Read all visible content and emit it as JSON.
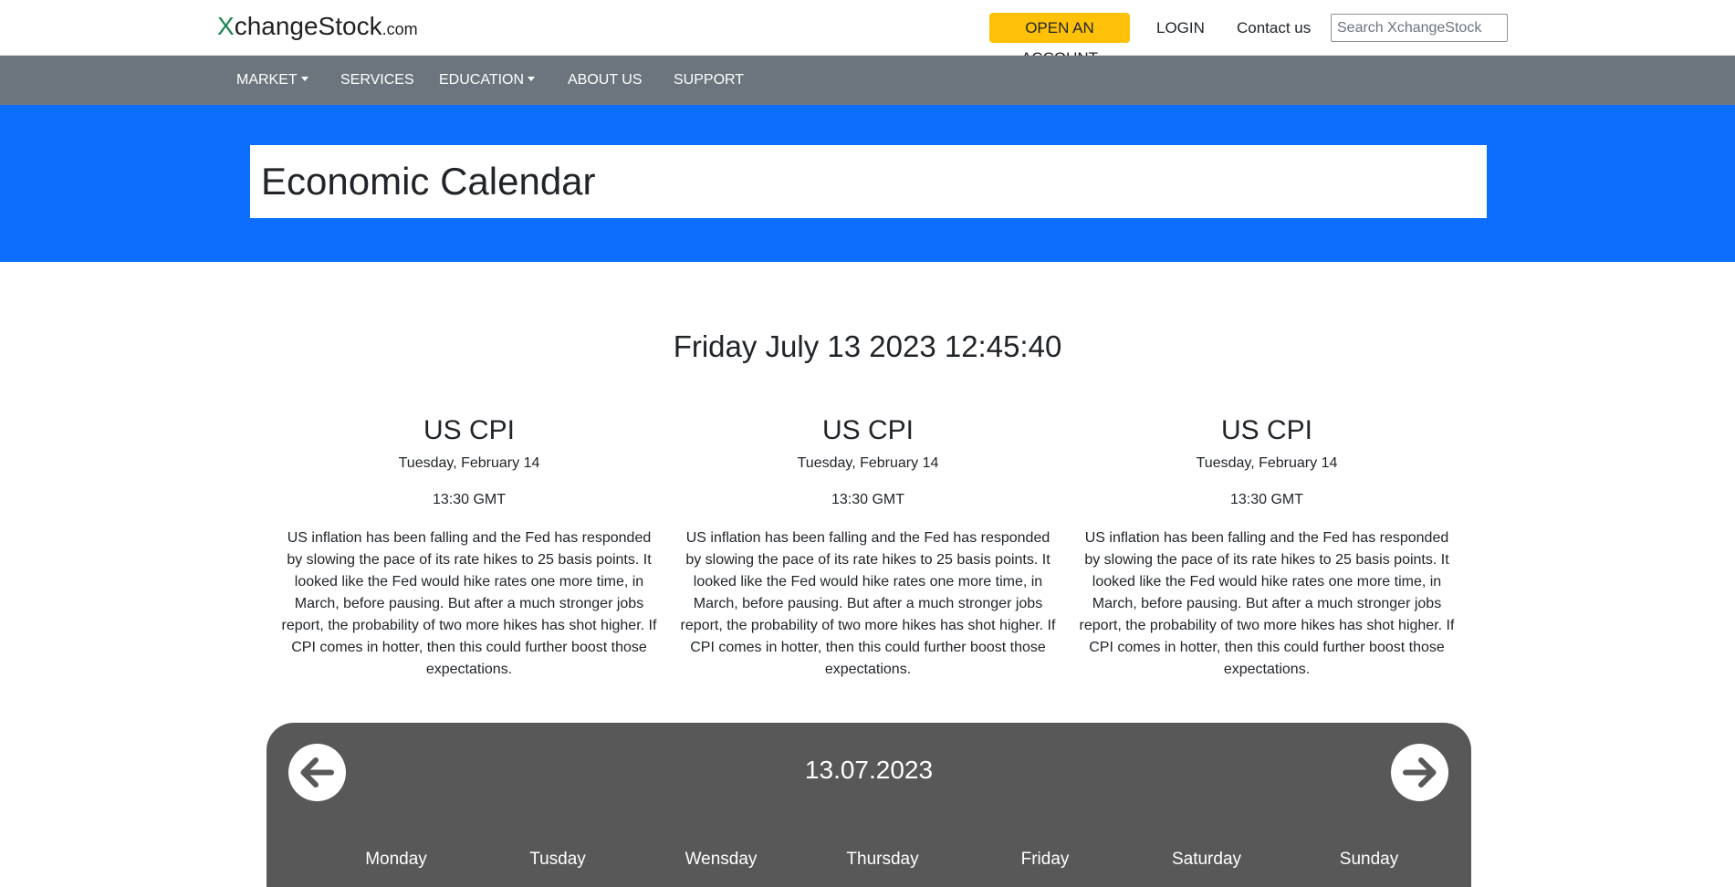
{
  "header": {
    "logo": {
      "initial": "X",
      "rest": "changeStock",
      "suffix": ".com"
    },
    "open_account_label": "OPEN AN ACCOUNT",
    "login_label": "LOGIN",
    "contact_label": "Contact us",
    "search": {
      "placeholder": "Search XchangeStock",
      "value": ""
    },
    "colors": {
      "logo_initial": "#198754",
      "open_account_bg": "#ffc107"
    }
  },
  "nav": {
    "items": [
      {
        "label": "MARKET",
        "dropdown": true
      },
      {
        "label": "SERVICES",
        "dropdown": false
      },
      {
        "label": "EDUCATION",
        "dropdown": true
      },
      {
        "label": "ABOUT US",
        "dropdown": false
      },
      {
        "label": "SUPPORT",
        "dropdown": false
      }
    ],
    "background": "#6c757d"
  },
  "hero": {
    "title": "Economic Calendar",
    "background": "#0d6efd"
  },
  "clock": {
    "text": "Friday July 13 2023 12:45:40"
  },
  "events": [
    {
      "title": "US CPI",
      "date": "Tuesday, February 14",
      "time": "13:30 GMT",
      "description": "US inflation has been falling and the Fed has responded by slowing the pace of its rate hikes to 25 basis points. It looked like the Fed would hike rates one more time, in March, before pausing. But after a much stronger jobs report, the probability of two more hikes has shot higher. If CPI comes in hotter, then this could further boost those expectations."
    },
    {
      "title": "US CPI",
      "date": "Tuesday, February 14",
      "time": "13:30 GMT",
      "description": "US inflation has been falling and the Fed has responded by slowing the pace of its rate hikes to 25 basis points. It looked like the Fed would hike rates one more time, in March, before pausing. But after a much stronger jobs report, the probability of two more hikes has shot higher. If CPI comes in hotter, then this could further boost those expectations."
    },
    {
      "title": "US CPI",
      "date": "Tuesday, February 14",
      "time": "13:30 GMT",
      "description": "US inflation has been falling and the Fed has responded by slowing the pace of its rate hikes to 25 basis points. It looked like the Fed would hike rates one more time, in March, before pausing. But after a much stronger jobs report, the probability of two more hikes has shot higher. If CPI comes in hotter, then this could further boost those expectations."
    }
  ],
  "calendar": {
    "current_date": "13.07.2023",
    "prev_icon": "arrow-left-icon",
    "next_icon": "arrow-right-icon",
    "weekdays": [
      "Monday",
      "Tusday",
      "Wensday",
      "Thursday",
      "Friday",
      "Saturday",
      "Sunday"
    ],
    "background": "#585858"
  }
}
